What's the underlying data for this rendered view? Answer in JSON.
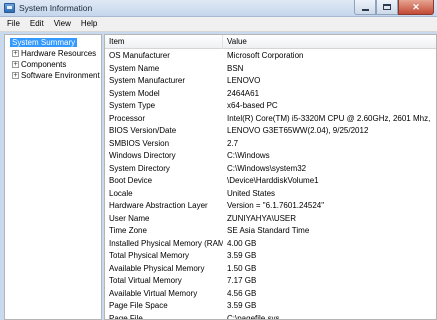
{
  "window": {
    "title": "System Information",
    "controls": {
      "minimize": "",
      "maximize": "",
      "close": "✕"
    }
  },
  "menu": [
    "File",
    "Edit",
    "View",
    "Help"
  ],
  "tree": {
    "items": [
      {
        "label": "System Summary",
        "expander": "",
        "selected": true
      },
      {
        "label": "Hardware Resources",
        "expander": "+"
      },
      {
        "label": "Components",
        "expander": "+"
      },
      {
        "label": "Software Environment",
        "expander": "+"
      }
    ]
  },
  "list": {
    "headers": {
      "item": "Item",
      "value": "Value"
    },
    "rows": [
      {
        "item": "OS Manufacturer",
        "value": "Microsoft Corporation"
      },
      {
        "item": "System Name",
        "value": "BSN"
      },
      {
        "item": "System Manufacturer",
        "value": "LENOVO"
      },
      {
        "item": "System Model",
        "value": "2464A61"
      },
      {
        "item": "System Type",
        "value": "x64-based PC"
      },
      {
        "item": "Processor",
        "value": "Intel(R) Core(TM) i5-3320M CPU @ 2.60GHz, 2601 Mhz,"
      },
      {
        "item": "BIOS Version/Date",
        "value": "LENOVO G3ET65WW(2.04), 9/25/2012"
      },
      {
        "item": "SMBIOS Version",
        "value": "2.7"
      },
      {
        "item": "Windows Directory",
        "value": "C:\\Windows"
      },
      {
        "item": "System Directory",
        "value": "C:\\Windows\\system32"
      },
      {
        "item": "Boot Device",
        "value": "\\Device\\HarddiskVolume1"
      },
      {
        "item": "Locale",
        "value": "United States"
      },
      {
        "item": "Hardware Abstraction Layer",
        "value": "Version = \"6.1.7601.24524\""
      },
      {
        "item": "User Name",
        "value": "ZUNIYAHYA\\USER"
      },
      {
        "item": "Time Zone",
        "value": "SE Asia Standard Time"
      },
      {
        "item": "Installed Physical Memory (RAM)",
        "value": "4.00 GB"
      },
      {
        "item": "Total Physical Memory",
        "value": "3.59 GB"
      },
      {
        "item": "Available Physical Memory",
        "value": "1.50 GB"
      },
      {
        "item": "Total Virtual Memory",
        "value": "7.17 GB"
      },
      {
        "item": "Available Virtual Memory",
        "value": "4.56 GB"
      },
      {
        "item": "Page File Space",
        "value": "3.59 GB"
      },
      {
        "item": "Page File",
        "value": "C:\\pagefile.sys"
      }
    ]
  },
  "colors": {
    "selection": "#3399ff",
    "title_bar": "#c5d6ec",
    "close_button": "#c24a34"
  },
  "icons": [
    "app-icon",
    "minimize-icon",
    "maximize-icon",
    "close-icon",
    "expand-icon"
  ]
}
